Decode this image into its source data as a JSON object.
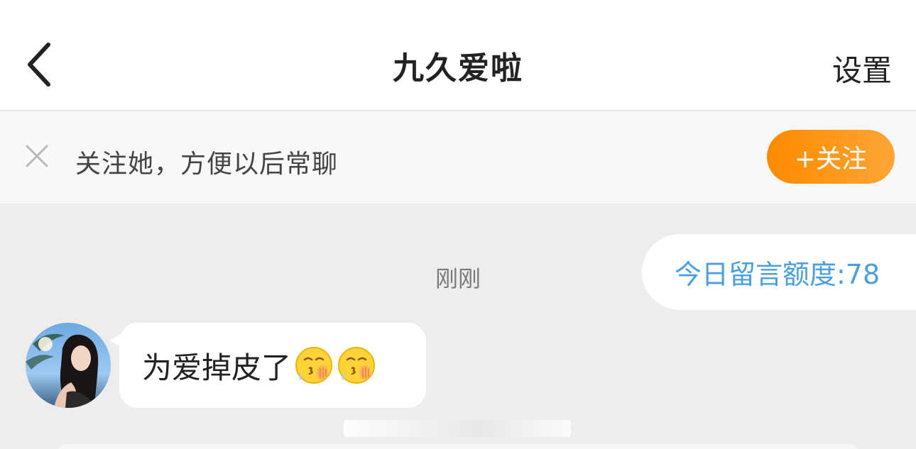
{
  "header": {
    "title": "九久爱啦",
    "settings_label": "设置",
    "back_icon": "chevron-left-icon"
  },
  "follow_banner": {
    "text": "关注她，方便以后常聊",
    "button_label": "+关注",
    "close_icon": "close-icon"
  },
  "chat": {
    "timestamp": "刚刚",
    "quota_message": "今日留言额度:78",
    "incoming_message": {
      "text": "为爱掉皮了",
      "emojis": [
        "blowing-kiss-emoji",
        "blowing-kiss-emoji"
      ]
    }
  },
  "colors": {
    "accent_orange": "#ff8a00",
    "quota_blue": "#4a9fe0",
    "chat_background": "#ededed"
  }
}
